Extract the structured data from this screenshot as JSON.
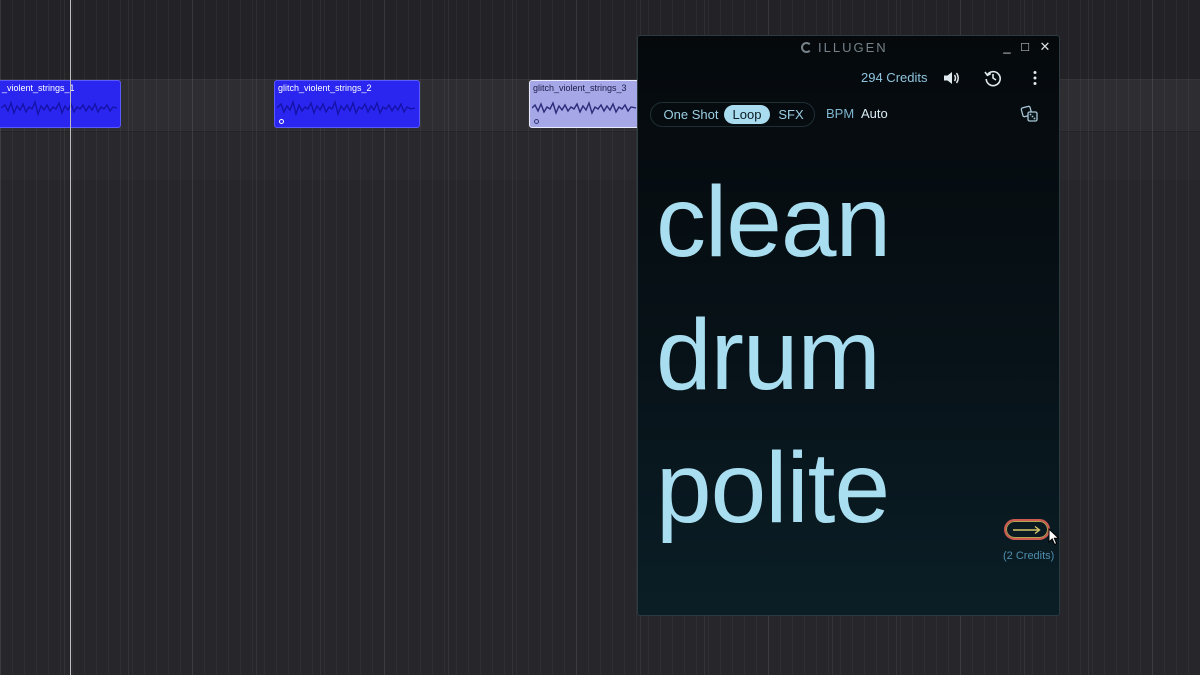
{
  "daw": {
    "clips": [
      {
        "label": "_violent_strings_1",
        "selected": false
      },
      {
        "label": "glitch_violent_strings_2",
        "selected": false
      },
      {
        "label": "glitch_violent_strings_3",
        "selected": true
      }
    ]
  },
  "plugin": {
    "brand": "ILLUGEN",
    "window_controls": {
      "minimize": "_",
      "maximize": "□",
      "close": "✕"
    },
    "credits": "294 Credits",
    "icons": {
      "volume": "speaker-icon",
      "history": "history-icon",
      "more": "more-vertical-icon",
      "dice": "dice-icon",
      "arrow": "arrow-right-icon"
    },
    "modes": [
      {
        "label": "One Shot",
        "active": false
      },
      {
        "label": "Loop",
        "active": true
      },
      {
        "label": "SFX",
        "active": false
      }
    ],
    "bpm_label": "BPM",
    "bpm_value": "Auto",
    "prompt_words": [
      "clean",
      "drum",
      "polite"
    ],
    "generate_cost": "(2 Credits)"
  },
  "colors": {
    "clip_blue": "#2a26f0",
    "clip_selected": "#a6a7e6",
    "prompt_text": "#a8def0",
    "accent_cyan": "#8ec5dd",
    "active_mode": "#a9dcef",
    "generate_red": "#cf5a52"
  }
}
